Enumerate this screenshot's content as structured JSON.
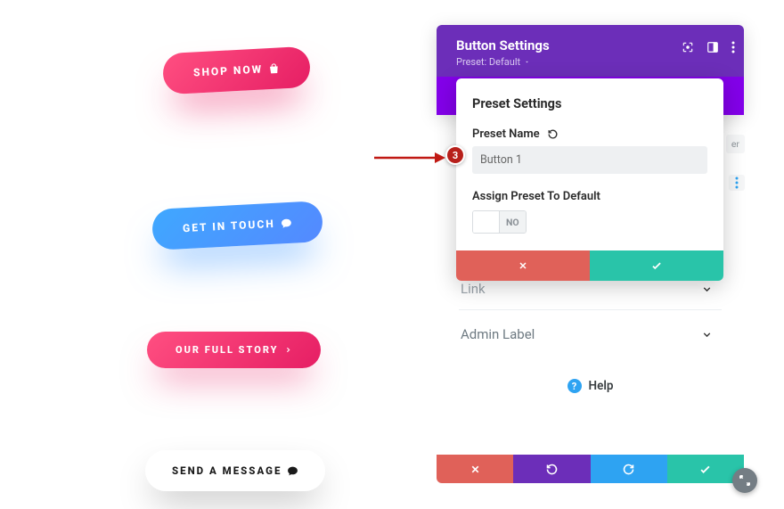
{
  "preview_buttons": {
    "shop": {
      "label": "SHOP NOW"
    },
    "touch": {
      "label": "GET IN TOUCH"
    },
    "story": {
      "label": "OUR FULL STORY"
    },
    "msg": {
      "label": "SEND A MESSAGE"
    }
  },
  "panel": {
    "title": "Button Settings",
    "preset_toggle": "Preset: Default"
  },
  "popup": {
    "title": "Preset Settings",
    "preset_name_label": "Preset Name",
    "preset_name_value": "Button 1",
    "assign_label": "Assign Preset To Default",
    "toggle_value": "NO"
  },
  "peek_text": "er",
  "accordion": {
    "link": "Link",
    "admin": "Admin Label"
  },
  "help_label": "Help",
  "callout_number": "3"
}
